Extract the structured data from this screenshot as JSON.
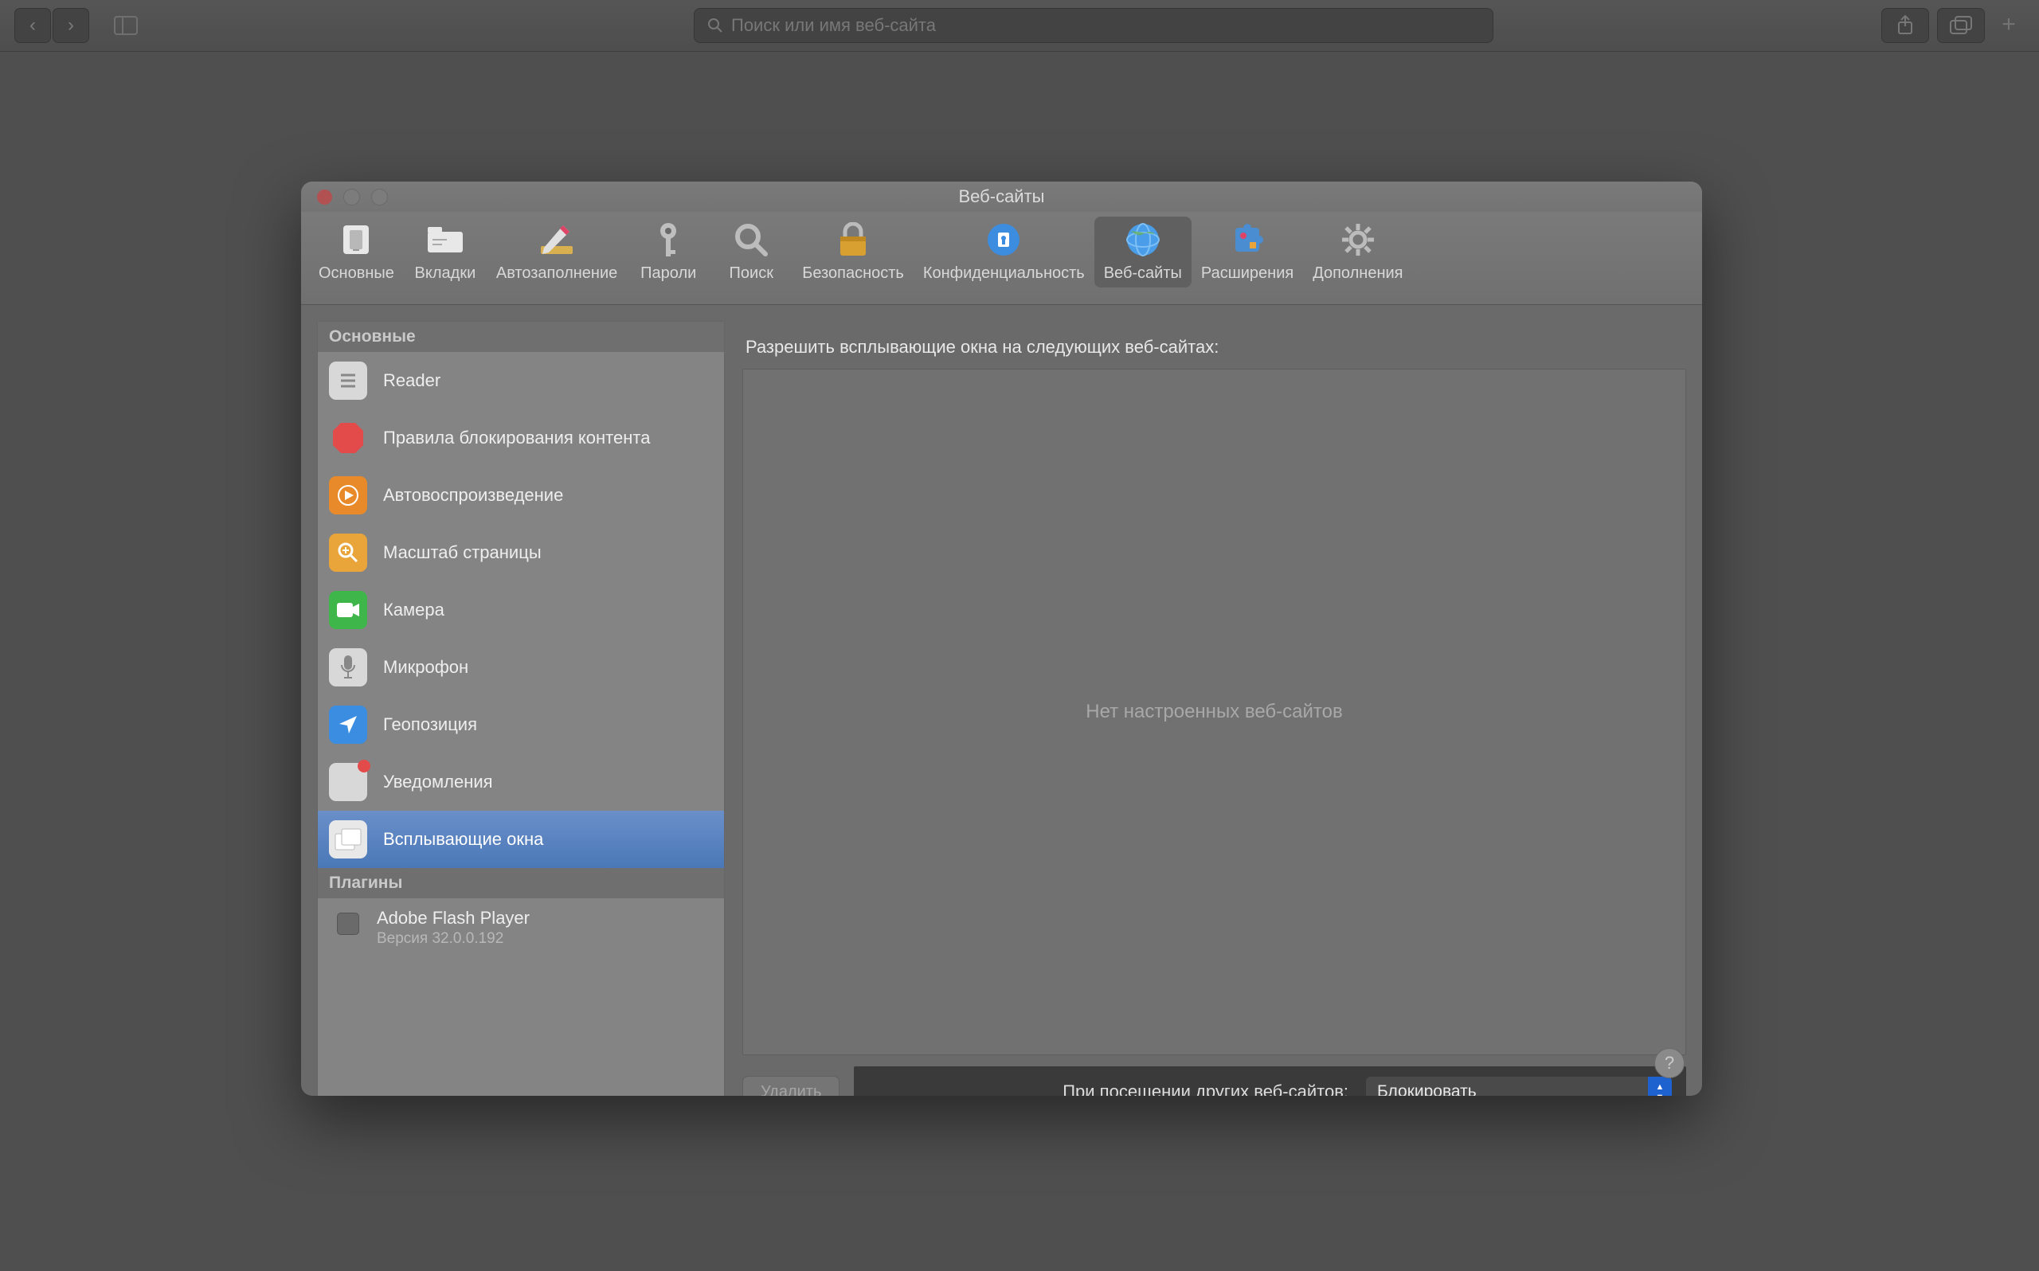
{
  "browser": {
    "search_placeholder": "Поиск или имя веб-сайта"
  },
  "window": {
    "title": "Веб-сайты"
  },
  "toolbar": {
    "items": [
      {
        "label": "Основные",
        "icon": "general"
      },
      {
        "label": "Вкладки",
        "icon": "tabs"
      },
      {
        "label": "Автозаполнение",
        "icon": "autofill"
      },
      {
        "label": "Пароли",
        "icon": "passwords"
      },
      {
        "label": "Поиск",
        "icon": "search"
      },
      {
        "label": "Безопасность",
        "icon": "security"
      },
      {
        "label": "Конфиденциальность",
        "icon": "privacy"
      },
      {
        "label": "Веб-сайты",
        "icon": "websites"
      },
      {
        "label": "Расширения",
        "icon": "extensions"
      },
      {
        "label": "Дополнения",
        "icon": "advanced"
      }
    ],
    "active_index": 7
  },
  "sidebar": {
    "sections": [
      {
        "title": "Основные",
        "items": [
          {
            "label": "Reader",
            "icon": "reader",
            "color": "#d0d0d0"
          },
          {
            "label": "Правила блокирования контента",
            "icon": "blocker",
            "color": "#e34b4b"
          },
          {
            "label": "Автовоспроизведение",
            "icon": "autoplay",
            "color": "#e98a2a"
          },
          {
            "label": "Масштаб страницы",
            "icon": "zoom",
            "color": "#e9a43a"
          },
          {
            "label": "Камера",
            "icon": "camera",
            "color": "#3fb64a"
          },
          {
            "label": "Микрофон",
            "icon": "microphone",
            "color": "#d0d0d0"
          },
          {
            "label": "Геопозиция",
            "icon": "location",
            "color": "#3a8de0"
          },
          {
            "label": "Уведомления",
            "icon": "notifications",
            "color": "#d0d0d0",
            "badge": true
          },
          {
            "label": "Всплывающие окна",
            "icon": "popups",
            "color": "#d0d0d0"
          }
        ],
        "selected_index": 8
      },
      {
        "title": "Плагины",
        "plugins": [
          {
            "name": "Adobe Flash Player",
            "version": "Версия 32.0.0.192",
            "enabled": false
          }
        ]
      }
    ]
  },
  "content": {
    "heading": "Разрешить всплывающие окна на следующих веб-сайтах:",
    "empty_message": "Нет настроенных веб-сайтов",
    "delete_label": "Удалить",
    "others_label": "При посещении других веб-сайтов:",
    "others_value": "Блокировать"
  }
}
